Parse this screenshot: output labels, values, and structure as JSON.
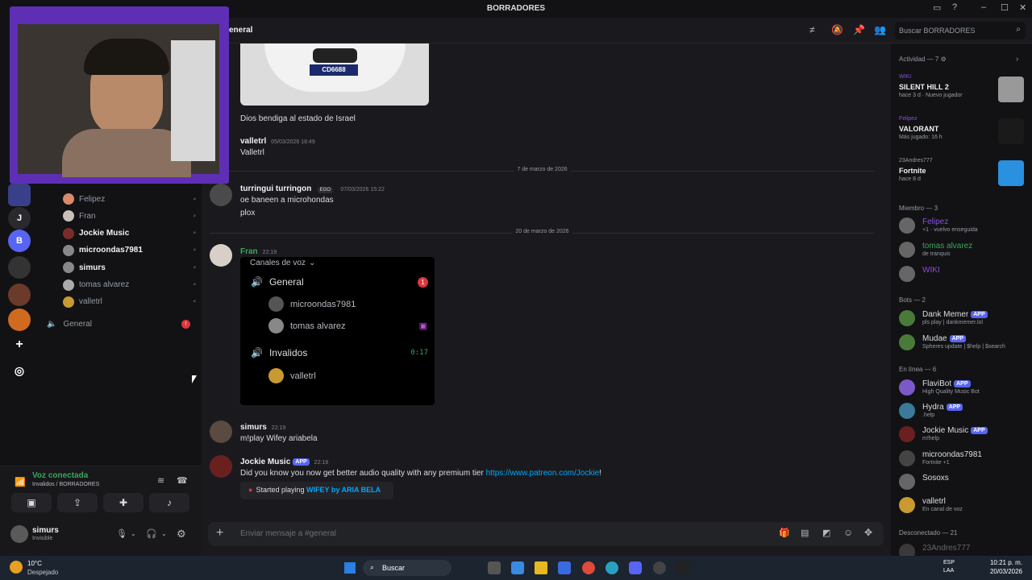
{
  "window": {
    "title": "BORRADORES"
  },
  "topbar": {
    "channel": "eneral",
    "search_placeholder": "Buscar BORRADORES"
  },
  "guilds": [
    "J",
    "B"
  ],
  "voice_users": [
    {
      "name": "Felipez",
      "bold": false,
      "color": "#d98a6a"
    },
    {
      "name": "Fran",
      "bold": false,
      "color": "#c8c0b8"
    },
    {
      "name": "Jockie Music",
      "bold": true,
      "color": "#7a2c2c"
    },
    {
      "name": "microondas7981",
      "bold": true,
      "color": "#888888"
    },
    {
      "name": "simurs",
      "bold": true,
      "color": "#888888"
    },
    {
      "name": "tomas alvarez",
      "bold": false,
      "color": "#aaaaaa"
    },
    {
      "name": "valletrl",
      "bold": false,
      "color": "#c89a30"
    }
  ],
  "general_channel": "General",
  "voice_panel": {
    "status": "Voz conectada",
    "location": "Invalidos / BORRADORES",
    "user": "simurs",
    "user_status": "Invisible"
  },
  "messages": {
    "m0": {
      "plate": "CD6688",
      "text": "Dios bendiga al estado de Israel"
    },
    "m1": {
      "user": "valletrl",
      "time": "05/03/2026 18:49",
      "text": "Valletrl"
    },
    "d1": "7 de marzo de 2026",
    "m2": {
      "user": "turringui turringon",
      "tag": "EGO",
      "time": "07/03/2026 15:22",
      "line1": "oe baneen a microhondas",
      "line2": "plox"
    },
    "d2": "20 de marzo de 2026",
    "m3": {
      "user": "Fran",
      "time": "22:19"
    },
    "m4": {
      "user": "simurs",
      "time": "22:19",
      "text": "m!play Wifey ariabela"
    },
    "m5": {
      "user": "Jockie Music",
      "app": "APP",
      "time": "22:19",
      "text": "Did you know you now get better audio quality with any premium tier ",
      "link": "https://www.patreon.com/Jockie",
      "tail": "!",
      "started": "Started playing ",
      "song": "WIFEY by ARIA BELA"
    }
  },
  "embed": {
    "header": "Canales de voz",
    "ch1": "General",
    "ch1_badge": "1",
    "u1": "microondas7981",
    "u2": "tomas alvarez",
    "ch2": "Invalidos",
    "ch2_time": "0:17",
    "u3": "valletrl"
  },
  "composer": {
    "placeholder": "Enviar mensaje a #general"
  },
  "members": {
    "activity_header": "Actividad — 7",
    "activities": [
      {
        "who": "WIKI",
        "game": "SILENT HILL 2",
        "detail": "hace 3 d  ·  Nuevo jugador",
        "who_color": "#8a4fd8"
      },
      {
        "who": "Felipez",
        "game": "VALORANT",
        "detail": "Más jugado: 16 h",
        "who_color": "#8a4fd8"
      },
      {
        "who": "23Andres777",
        "game": "Fortnite",
        "detail": "hace 8 d",
        "who_color": "#949ba4"
      }
    ],
    "member_header": "Miembro — 3",
    "members": [
      {
        "name": "Felipez",
        "status": "+1 · vuelvo enseguida",
        "color": "#8a4fd8"
      },
      {
        "name": "tomas alvarez",
        "status": "de tranquis",
        "color": "#3ba55d"
      },
      {
        "name": "WIKI",
        "status": "",
        "color": "#8a4fd8"
      }
    ],
    "bots_header": "Bots — 2",
    "bots": [
      {
        "name": "Dank Memer",
        "status": "pls play | dankmemer.lol"
      },
      {
        "name": "Mudae",
        "status": "Spheres update | $help | $search"
      }
    ],
    "online_header": "En línea — 6",
    "online": [
      {
        "name": "FlaviBot",
        "app": true,
        "status": "High Quality Music Bot"
      },
      {
        "name": "Hydra",
        "app": true,
        "status": ".help"
      },
      {
        "name": "Jockie Music",
        "app": true,
        "status": "m!help"
      },
      {
        "name": "microondas7981",
        "app": false,
        "status": "Fortnite +1"
      },
      {
        "name": "Sosoxs",
        "app": false,
        "status": ""
      },
      {
        "name": "valletrl",
        "app": false,
        "status": "En canal de voz"
      }
    ],
    "offline_header": "Desconectado — 21",
    "offline_first": "23Andres777",
    "app_label": "APP"
  },
  "taskbar": {
    "temp": "10°C",
    "weather": "Despejado",
    "search": "Buscar",
    "lang1": "ESP",
    "lang2": "LAA",
    "time": "10:21 p. m.",
    "date": "20/03/2026"
  }
}
